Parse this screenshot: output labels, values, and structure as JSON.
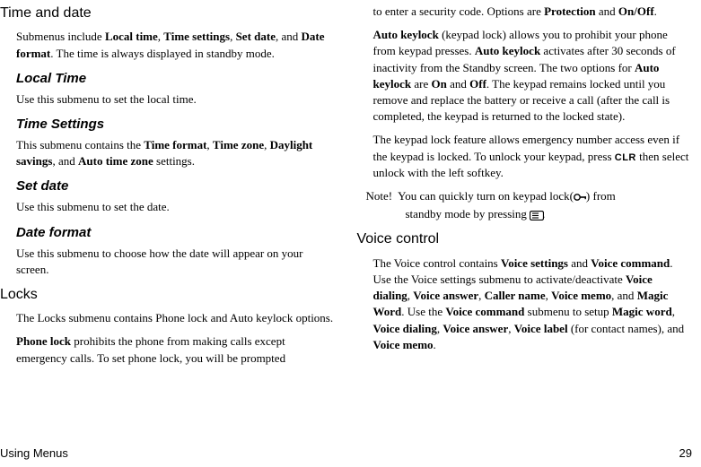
{
  "left": {
    "time_date": {
      "title": "Time and date"
    },
    "intro": {
      "t1": "Submenus include ",
      "b1": "Local time",
      "t2": ", ",
      "b2": "Time settings",
      "t3": ", ",
      "b3": "Set date",
      "t4": ", and ",
      "b4": "Date format",
      "t5": ". The time is always displayed in standby mode."
    },
    "local_time": {
      "title": "Local Time",
      "body": "Use this submenu to set the local time."
    },
    "time_settings": {
      "title": "Time Settings",
      "t1": "This submenu contains the ",
      "b1": "Time format",
      "t2": ", ",
      "b2": "Time zone",
      "t3": ", ",
      "b3": "Daylight savings",
      "t4": ", and ",
      "b4": "Auto time zone",
      "t5": " settings."
    },
    "set_date": {
      "title": "Set date",
      "body": "Use this submenu to set the date."
    },
    "date_format": {
      "title": "Date format",
      "body": "Use this submenu to choose how the date will appear on your screen."
    },
    "locks": {
      "title": "Locks",
      "p1": "The Locks submenu contains Phone lock and Auto keylock options.",
      "p2a": "Phone lock",
      "p2b": " prohibits the phone from making calls except emergency calls. To set phone lock, you will be prompted"
    }
  },
  "right": {
    "p1": {
      "t1": "to enter a security code. Options are ",
      "b1": "Protection",
      "t2": " and ",
      "b2": "On/Off",
      "t3": "."
    },
    "p2": {
      "b1": "Auto keylock",
      "t1": " (keypad lock) allows you to prohibit your phone from keypad presses. ",
      "b2": "Auto keylock",
      "t2": " activates after 30 seconds of inactivity from the Standby screen. The two options for ",
      "b3": "Auto keylock",
      "t3": " are ",
      "b4": "On",
      "t4": " and ",
      "b5": "Off",
      "t5": ". The keypad remains locked until you remove and replace the battery or receive a call (after the call is completed, the keypad is returned to the locked state)."
    },
    "p3": {
      "t1": "The keypad lock feature allows emergency number access even if the keypad is locked. To unlock your keypad, press ",
      "clr": "CLR",
      "t2": " then select unlock with the left softkey."
    },
    "note": {
      "label": "Note!",
      "l1a": "You can quickly turn on keypad lock(",
      "l1b": ") from",
      "l2a": "standby mode by pressing ",
      "l2b": "."
    },
    "voice": {
      "title": "Voice control",
      "t1": "The Voice control contains ",
      "b1": "Voice settings",
      "t2": " and ",
      "b2": "Voice command",
      "t3": ". Use the Voice settings submenu to activate/deactivate ",
      "b3": "Voice dialing",
      "t4": ", ",
      "b4": "Voice answer",
      "t5": ", ",
      "b5": "Caller name",
      "t6": ", ",
      "b6": "Voice memo",
      "t7": ", and ",
      "b7": "Magic Word",
      "t8": ". Use the ",
      "b8": "Voice command",
      "t9": " submenu to setup ",
      "b9": "Magic word",
      "t10": ", ",
      "b10": "Voice dialing",
      "t11": ", ",
      "b11": "Voice answer",
      "t12": ", ",
      "b12": "Voice label",
      "t13": " (for contact names), and ",
      "b13": "Voice memo",
      "t14": "."
    }
  },
  "footer": {
    "left": "Using Menus",
    "right": "29"
  }
}
